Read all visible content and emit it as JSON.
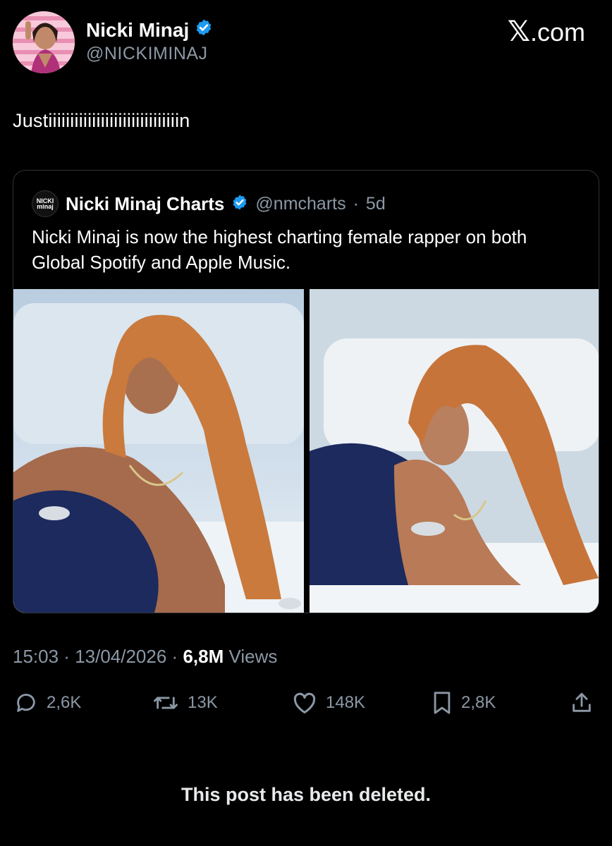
{
  "author": {
    "name": "Nicki Minaj",
    "handle": "@NICKIMINAJ",
    "verified": true
  },
  "brand": {
    "x_glyph": "𝕏",
    "domain": ".com"
  },
  "post": {
    "text": "Justiiiiiiiiiiiiiiiiiiiiiiiiiiiiiin"
  },
  "quoted_post": {
    "logo_text_top": "NICKI",
    "logo_text_bottom": "minaj",
    "name": "Nicki Minaj Charts",
    "verified": true,
    "handle": "@nmcharts",
    "separator": "·",
    "age": "5d",
    "text": "Nicki Minaj is now the highest charting female rapper on both Global Spotify and Apple Music.",
    "images": [
      "photo-reclining-on-bed-left",
      "photo-reclining-on-bed-right"
    ]
  },
  "meta": {
    "time": "15:03",
    "sep1": " · ",
    "date": "13/04/2026",
    "sep2": " · ",
    "views_count": "6,8M",
    "views_label": " Views"
  },
  "actions": {
    "replies": "2,6K",
    "reposts": "13K",
    "likes": "148K",
    "bookmarks": "2,8K"
  },
  "icons": {
    "verified": "verified-badge-icon",
    "reply": "reply-icon",
    "repost": "repost-icon",
    "like": "heart-icon",
    "bookmark": "bookmark-icon",
    "share": "share-icon"
  },
  "colors": {
    "background": "#000000",
    "verified_blue": "#1d9bf0",
    "secondary_text": "#8b98a5"
  },
  "footer": {
    "notice": "This post has been deleted."
  }
}
